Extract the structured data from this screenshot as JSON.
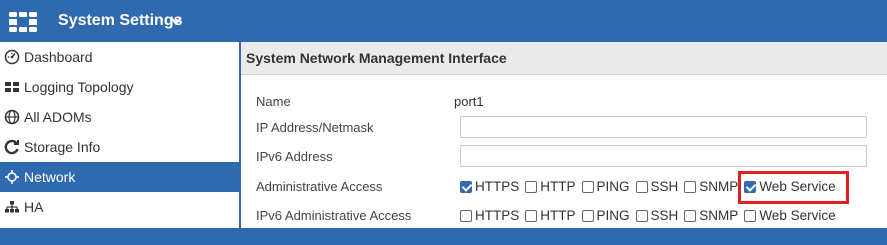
{
  "header": {
    "title": "System Settings"
  },
  "sidebar": {
    "items": [
      {
        "label": "Dashboard",
        "icon": "dashboard-icon"
      },
      {
        "label": "Logging Topology",
        "icon": "topology-icon"
      },
      {
        "label": "All ADOMs",
        "icon": "globe-icon"
      },
      {
        "label": "Storage Info",
        "icon": "refresh-icon"
      },
      {
        "label": "Network",
        "icon": "network-icon",
        "active": true
      },
      {
        "label": "HA",
        "icon": "ha-icon"
      }
    ]
  },
  "panel": {
    "title": "System Network Management Interface",
    "name_label": "Name",
    "name_value": "port1",
    "ip_label": "IP Address/Netmask",
    "ip_value": "",
    "ipv6_label": "IPv6 Address",
    "ipv6_value": "",
    "admin_label": "Administrative Access",
    "ipv6_admin_label": "IPv6 Administrative Access"
  },
  "admin_access": [
    {
      "label": "HTTPS",
      "checked": true
    },
    {
      "label": "HTTP",
      "checked": false
    },
    {
      "label": "PING",
      "checked": false
    },
    {
      "label": "SSH",
      "checked": false
    },
    {
      "label": "SNMP",
      "checked": false
    },
    {
      "label": "Web Service",
      "checked": true
    }
  ],
  "ipv6_admin_access": [
    {
      "label": "HTTPS",
      "checked": false
    },
    {
      "label": "HTTP",
      "checked": false
    },
    {
      "label": "PING",
      "checked": false
    },
    {
      "label": "SSH",
      "checked": false
    },
    {
      "label": "SNMP",
      "checked": false
    },
    {
      "label": "Web Service",
      "checked": false
    }
  ],
  "colors": {
    "accent": "#2f6ab1",
    "highlight": "#e02020"
  }
}
